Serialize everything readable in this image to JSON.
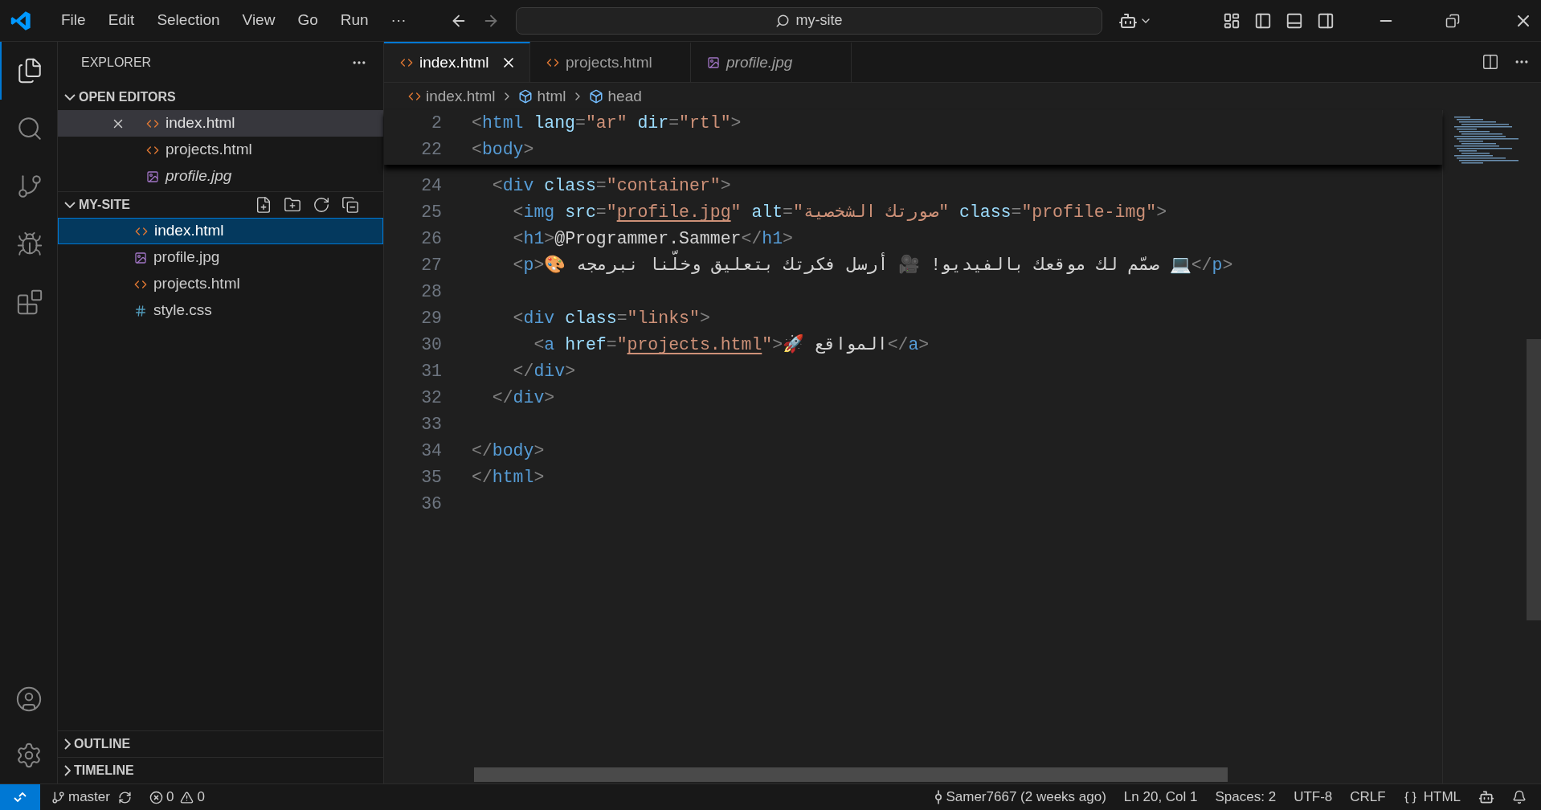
{
  "title_bar": {
    "menu": [
      "File",
      "Edit",
      "Selection",
      "View",
      "Go",
      "Run",
      "···"
    ],
    "search": "my-site"
  },
  "activity_bar": [
    {
      "kind": "explorer",
      "selected": true
    },
    {
      "kind": "search",
      "selected": false
    },
    {
      "kind": "scm",
      "selected": false
    },
    {
      "kind": "debug",
      "selected": false
    },
    {
      "kind": "extensions",
      "selected": false
    }
  ],
  "sidebar": {
    "title": "EXPLORER",
    "open_editors": {
      "title": "OPEN EDITORS",
      "expanded": true,
      "items": [
        {
          "name": "index.html",
          "kind": "html",
          "preview": false,
          "selected": true
        },
        {
          "name": "projects.html",
          "kind": "html",
          "preview": false,
          "selected": false
        },
        {
          "name": "profile.jpg",
          "kind": "image",
          "preview": true,
          "selected": false
        }
      ]
    },
    "folder": {
      "title": "MY-SITE",
      "expanded": true,
      "items": [
        {
          "name": "index.html",
          "kind": "html",
          "selected": true
        },
        {
          "name": "profile.jpg",
          "kind": "image",
          "selected": false
        },
        {
          "name": "projects.html",
          "kind": "html",
          "selected": false
        },
        {
          "name": "style.css",
          "kind": "css",
          "selected": false
        }
      ]
    },
    "panels": [
      {
        "title": "OUTLINE",
        "expanded": false
      },
      {
        "title": "TIMELINE",
        "expanded": false
      }
    ]
  },
  "tabs": [
    {
      "label": "index.html",
      "kind": "html",
      "preview": false,
      "selected": true
    },
    {
      "label": "projects.html",
      "kind": "html",
      "preview": false,
      "selected": false
    },
    {
      "label": "profile.jpg",
      "kind": "image",
      "preview": true,
      "selected": false
    }
  ],
  "breadcrumb": [
    {
      "label": "index.html",
      "kind": "file"
    },
    {
      "label": "html",
      "kind": "element"
    },
    {
      "label": "head",
      "kind": "element"
    }
  ],
  "sticky_lines": [
    {
      "number": "2",
      "tokens": [
        {
          "kind": "punct",
          "text": "<"
        },
        {
          "kind": "tag",
          "text": "html"
        },
        {
          "kind": "attr",
          "text": " lang"
        },
        {
          "kind": "punct",
          "text": "="
        },
        {
          "kind": "str",
          "text": "\"ar\""
        },
        {
          "kind": "attr",
          "text": " dir"
        },
        {
          "kind": "punct",
          "text": "="
        },
        {
          "kind": "str",
          "text": "\"rtl\""
        },
        {
          "kind": "punct",
          "text": ">"
        }
      ]
    },
    {
      "number": "22",
      "tokens": [
        {
          "kind": "punct",
          "text": "<"
        },
        {
          "kind": "tag",
          "text": "body"
        },
        {
          "kind": "punct",
          "text": ">"
        }
      ]
    }
  ],
  "code_lines": [
    {
      "number": "24",
      "tokens": [
        {
          "kind": "punct",
          "text": "  <"
        },
        {
          "kind": "tag",
          "text": "div"
        },
        {
          "kind": "attr",
          "text": " class"
        },
        {
          "kind": "punct",
          "text": "="
        },
        {
          "kind": "str",
          "text": "\"container\""
        },
        {
          "kind": "punct",
          "text": ">"
        }
      ]
    },
    {
      "number": "25",
      "tokens": [
        {
          "kind": "punct",
          "text": "    <"
        },
        {
          "kind": "tag",
          "text": "img"
        },
        {
          "kind": "attr",
          "text": " src"
        },
        {
          "kind": "punct",
          "text": "="
        },
        {
          "kind": "str",
          "text": "\""
        },
        {
          "kind": "link",
          "text": "profile.jpg"
        },
        {
          "kind": "str",
          "text": "\""
        },
        {
          "kind": "attr",
          "text": " alt"
        },
        {
          "kind": "punct",
          "text": "="
        },
        {
          "kind": "str",
          "text": "\"صورتك الشخصية\""
        },
        {
          "kind": "attr",
          "text": " class"
        },
        {
          "kind": "punct",
          "text": "="
        },
        {
          "kind": "str",
          "text": "\"profile-img\""
        },
        {
          "kind": "punct",
          "text": ">"
        }
      ]
    },
    {
      "number": "26",
      "tokens": [
        {
          "kind": "punct",
          "text": "    <"
        },
        {
          "kind": "tag",
          "text": "h1"
        },
        {
          "kind": "punct",
          "text": ">"
        },
        {
          "kind": "text",
          "text": "@Programmer.Sammer"
        },
        {
          "kind": "punct",
          "text": "</"
        },
        {
          "kind": "tag",
          "text": "h1"
        },
        {
          "kind": "punct",
          "text": ">"
        }
      ]
    },
    {
      "number": "27",
      "tokens": [
        {
          "kind": "punct",
          "text": "    <"
        },
        {
          "kind": "tag",
          "text": "p"
        },
        {
          "kind": "punct",
          "text": ">"
        },
        {
          "kind": "text",
          "text": "🎨 صمّم لك موقعك بالفيديو! 🎥 أرسل فكرتك بتعليق وخلّنا نبرمجه 💻"
        },
        {
          "kind": "punct",
          "text": "</"
        },
        {
          "kind": "tag",
          "text": "p"
        },
        {
          "kind": "punct",
          "text": ">"
        }
      ]
    },
    {
      "number": "28"
    },
    {
      "number": "29",
      "tokens": [
        {
          "kind": "punct",
          "text": "    <"
        },
        {
          "kind": "tag",
          "text": "div"
        },
        {
          "kind": "attr",
          "text": " class"
        },
        {
          "kind": "punct",
          "text": "="
        },
        {
          "kind": "str",
          "text": "\"links\""
        },
        {
          "kind": "punct",
          "text": ">"
        }
      ]
    },
    {
      "number": "30",
      "tokens": [
        {
          "kind": "punct",
          "text": "      <"
        },
        {
          "kind": "tag",
          "text": "a"
        },
        {
          "kind": "attr",
          "text": " href"
        },
        {
          "kind": "punct",
          "text": "="
        },
        {
          "kind": "str",
          "text": "\""
        },
        {
          "kind": "link",
          "text": "projects.html"
        },
        {
          "kind": "str",
          "text": "\""
        },
        {
          "kind": "punct",
          "text": ">"
        },
        {
          "kind": "text",
          "text": "🚀 المواقع"
        },
        {
          "kind": "punct",
          "text": "</"
        },
        {
          "kind": "tag",
          "text": "a"
        },
        {
          "kind": "punct",
          "text": ">"
        }
      ]
    },
    {
      "number": "31",
      "tokens": [
        {
          "kind": "punct",
          "text": "    </"
        },
        {
          "kind": "tag",
          "text": "div"
        },
        {
          "kind": "punct",
          "text": ">"
        }
      ]
    },
    {
      "number": "32",
      "tokens": [
        {
          "kind": "punct",
          "text": "  </"
        },
        {
          "kind": "tag",
          "text": "div"
        },
        {
          "kind": "punct",
          "text": ">"
        }
      ]
    },
    {
      "number": "33"
    },
    {
      "number": "34",
      "tokens": [
        {
          "kind": "punct",
          "text": "</"
        },
        {
          "kind": "tag",
          "text": "body"
        },
        {
          "kind": "punct",
          "text": ">"
        }
      ]
    },
    {
      "number": "35",
      "tokens": [
        {
          "kind": "punct",
          "text": "</"
        },
        {
          "kind": "tag",
          "text": "html"
        },
        {
          "kind": "punct",
          "text": ">"
        }
      ]
    },
    {
      "number": "36"
    }
  ],
  "status_bar": {
    "branch": "master",
    "errors": "0",
    "warnings": "0",
    "blame": "Samer7667 (2 weeks ago)",
    "position": "Ln 20, Col 1",
    "indent": "Spaces: 2",
    "encoding": "UTF-8",
    "eol": "CRLF",
    "language": "HTML"
  }
}
